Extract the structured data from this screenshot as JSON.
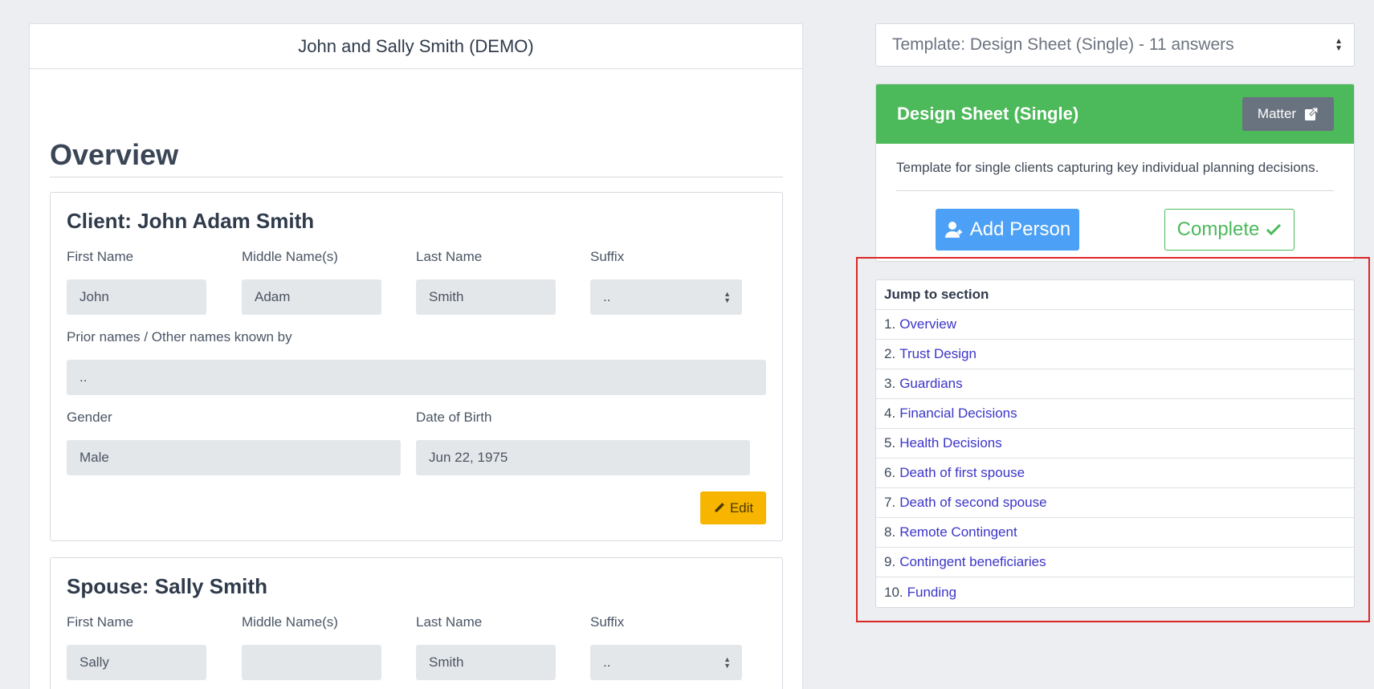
{
  "header": {
    "title": "John and Sally Smith (DEMO)"
  },
  "overview": {
    "title": "Overview"
  },
  "client": {
    "title": "Client: John Adam Smith",
    "labels": {
      "first": "First Name",
      "middle": "Middle Name(s)",
      "last": "Last Name",
      "suffix": "Suffix",
      "prior": "Prior names / Other names known by",
      "gender": "Gender",
      "dob": "Date of Birth"
    },
    "values": {
      "first": "John",
      "middle": "Adam",
      "last": "Smith",
      "suffix": "..",
      "prior": "..",
      "gender": "Male",
      "dob": "Jun 22, 1975"
    },
    "edit_label": "Edit"
  },
  "spouse": {
    "title": "Spouse: Sally Smith",
    "labels": {
      "first": "First Name",
      "middle": "Middle Name(s)",
      "last": "Last Name",
      "suffix": "Suffix"
    },
    "values": {
      "first": "Sally",
      "middle": "",
      "last": "Smith",
      "suffix": ".."
    }
  },
  "template_select": {
    "value": "Template: Design Sheet (Single) - 11 answers"
  },
  "design": {
    "title": "Design Sheet (Single)",
    "matter_label": "Matter",
    "description": "Template for single clients capturing key individual planning decisions.",
    "add_person_label": "Add Person",
    "complete_label": "Complete",
    "header_color": "#4cb95a"
  },
  "jump": {
    "heading": "Jump to section",
    "items": [
      {
        "num": "1.",
        "label": "Overview"
      },
      {
        "num": "2.",
        "label": "Trust Design"
      },
      {
        "num": "3.",
        "label": "Guardians"
      },
      {
        "num": "4.",
        "label": "Financial Decisions"
      },
      {
        "num": "5.",
        "label": "Health Decisions"
      },
      {
        "num": "6.",
        "label": "Death of first spouse"
      },
      {
        "num": "7.",
        "label": "Death of second spouse"
      },
      {
        "num": "8.",
        "label": "Remote Contingent"
      },
      {
        "num": "9.",
        "label": "Contingent beneficiaries"
      },
      {
        "num": "10.",
        "label": "Funding"
      }
    ]
  }
}
